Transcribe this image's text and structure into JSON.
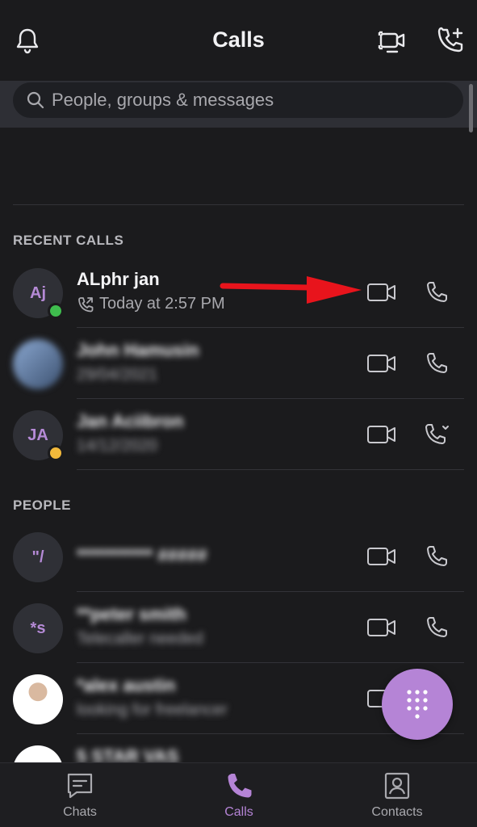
{
  "header": {
    "title": "Calls"
  },
  "search": {
    "placeholder": "People, groups & messages"
  },
  "sections": {
    "recent": "RECENT CALLS",
    "people": "PEOPLE"
  },
  "recent_calls": [
    {
      "initials": "Aj",
      "name": "ALphr jan",
      "detail": "Today at 2:57 PM",
      "status": "online"
    },
    {
      "initials": "",
      "name": "John Hamusin",
      "detail": "29/04/2021"
    },
    {
      "initials": "JA",
      "name": "Jan Aciibron",
      "detail": "14/12/2020",
      "status": "away"
    }
  ],
  "people": [
    {
      "initials": "\"/",
      "name": "*********** #####",
      "detail": ""
    },
    {
      "initials": "*s",
      "name": "**peter smith",
      "detail": "Telecaller needed"
    },
    {
      "initials": "",
      "name": "*alex austin",
      "detail": "looking for freelancer"
    },
    {
      "initials": "",
      "name": "5 STAR VAS",
      "detail": ""
    }
  ],
  "tabs": [
    {
      "label": "Chats",
      "active": false
    },
    {
      "label": "Calls",
      "active": true
    },
    {
      "label": "Contacts",
      "active": false
    }
  ],
  "colors": {
    "accent": "#b584d6",
    "background": "#1b1b1d",
    "online": "#3fbd4e",
    "away": "#f2b93b",
    "arrow": "#e8141c"
  }
}
